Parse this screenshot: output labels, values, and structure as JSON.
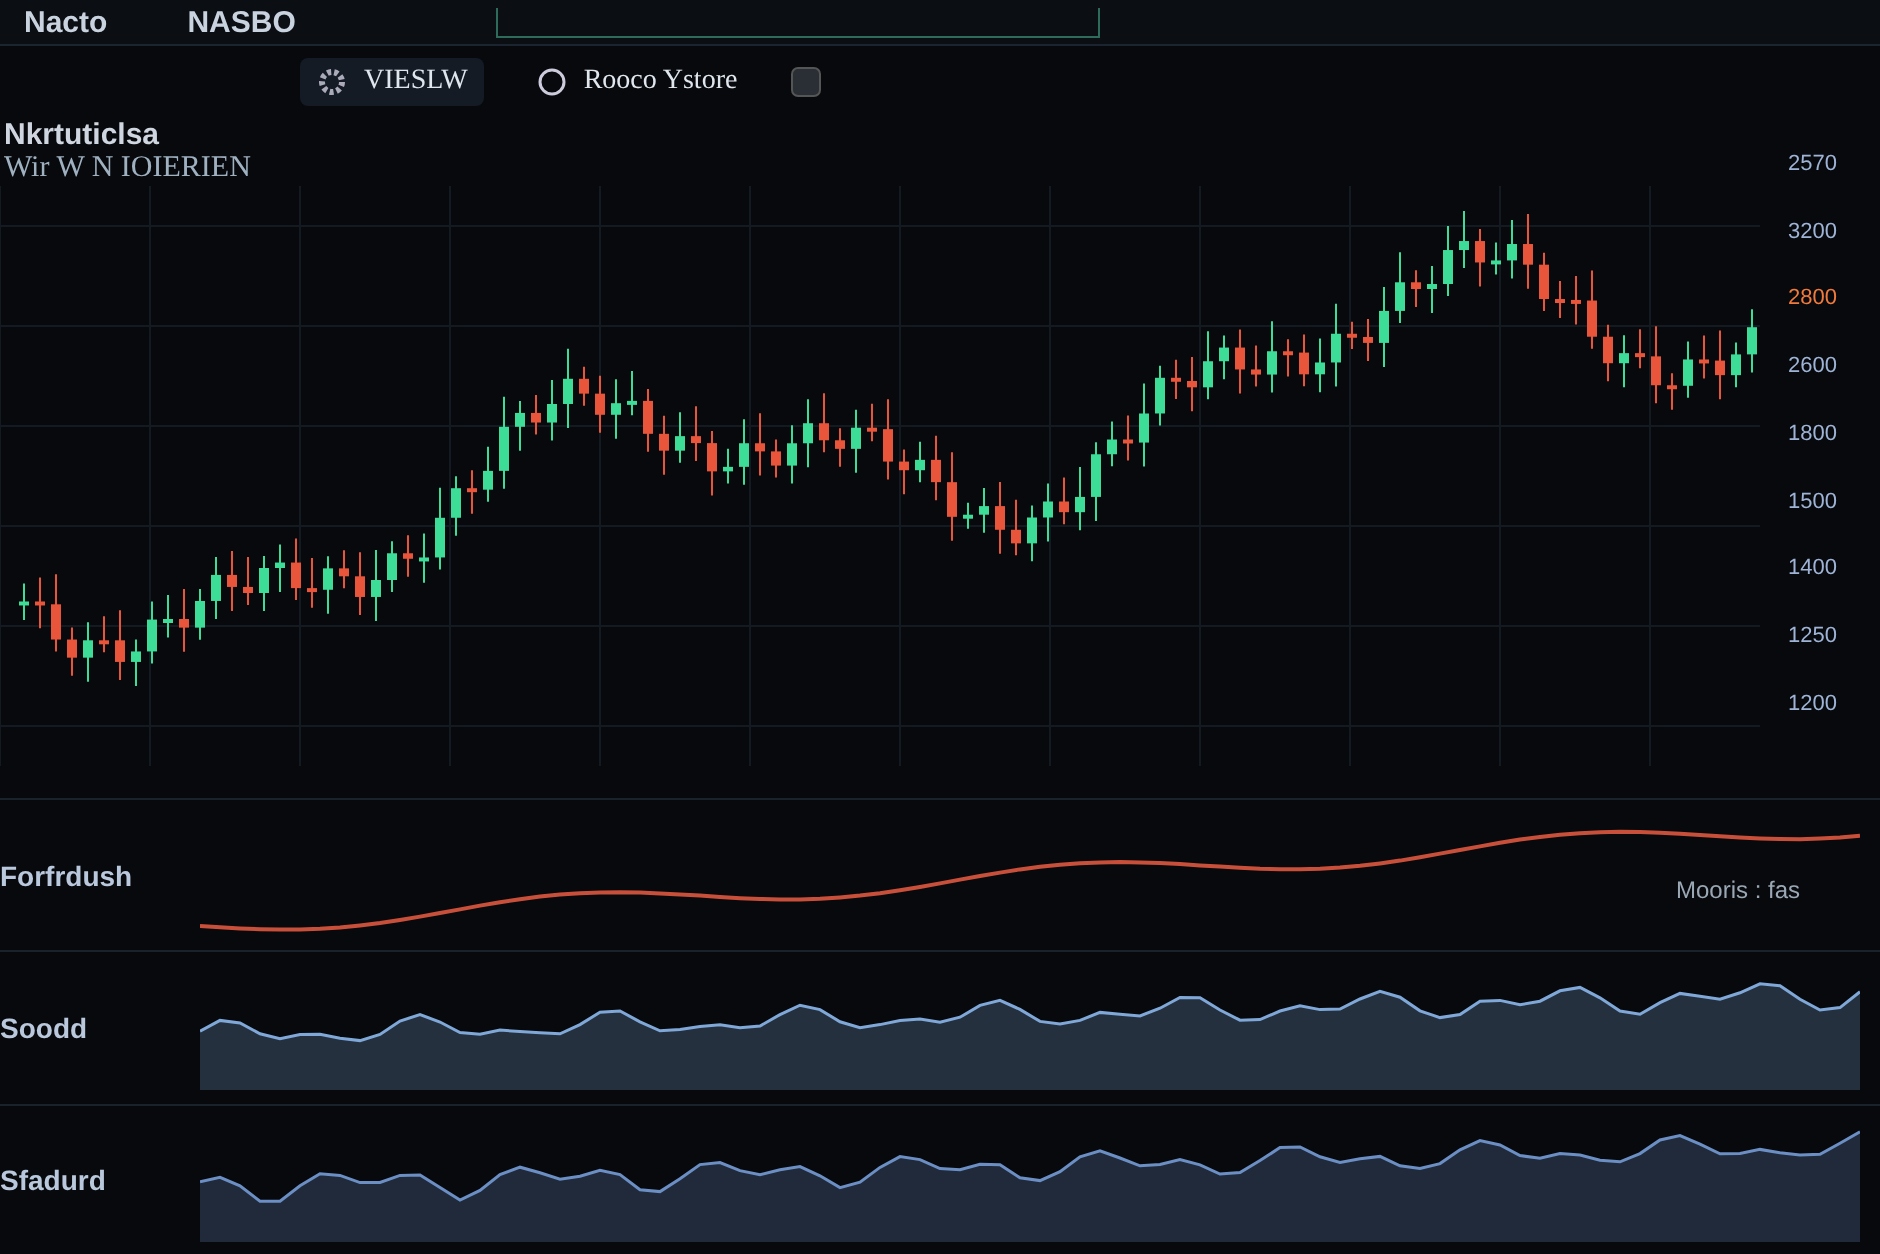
{
  "header": {
    "items": [
      {
        "label": "Nacto"
      },
      {
        "label": "NASBO"
      }
    ]
  },
  "toolbar": {
    "buttons": [
      {
        "label": "VIESLW",
        "selected": true
      },
      {
        "label": "Rooco Ystore",
        "selected": false
      }
    ]
  },
  "chart": {
    "title": "Nkrtuticlsa",
    "subtitle": "Wir W N IOIERIEN",
    "price_labels": [
      {
        "text": "2570",
        "highlighted": false
      },
      {
        "text": "3200",
        "highlighted": false
      },
      {
        "text": "2800",
        "highlighted": true
      },
      {
        "text": "2600",
        "highlighted": false
      },
      {
        "text": "1800",
        "highlighted": false
      },
      {
        "text": "1500",
        "highlighted": false
      },
      {
        "text": "1400",
        "highlighted": false
      },
      {
        "text": "1250",
        "highlighted": false
      },
      {
        "text": "1200",
        "highlighted": false
      }
    ]
  },
  "indicators": [
    {
      "label": "Forfrdush",
      "kind": "line",
      "color": "#c8503a",
      "note": "Mooris : fas"
    },
    {
      "label": "Soodd",
      "kind": "area",
      "color": "#7fa8d8"
    },
    {
      "label": "Sfadurd",
      "kind": "area",
      "color": "#6b8fc4"
    }
  ]
}
